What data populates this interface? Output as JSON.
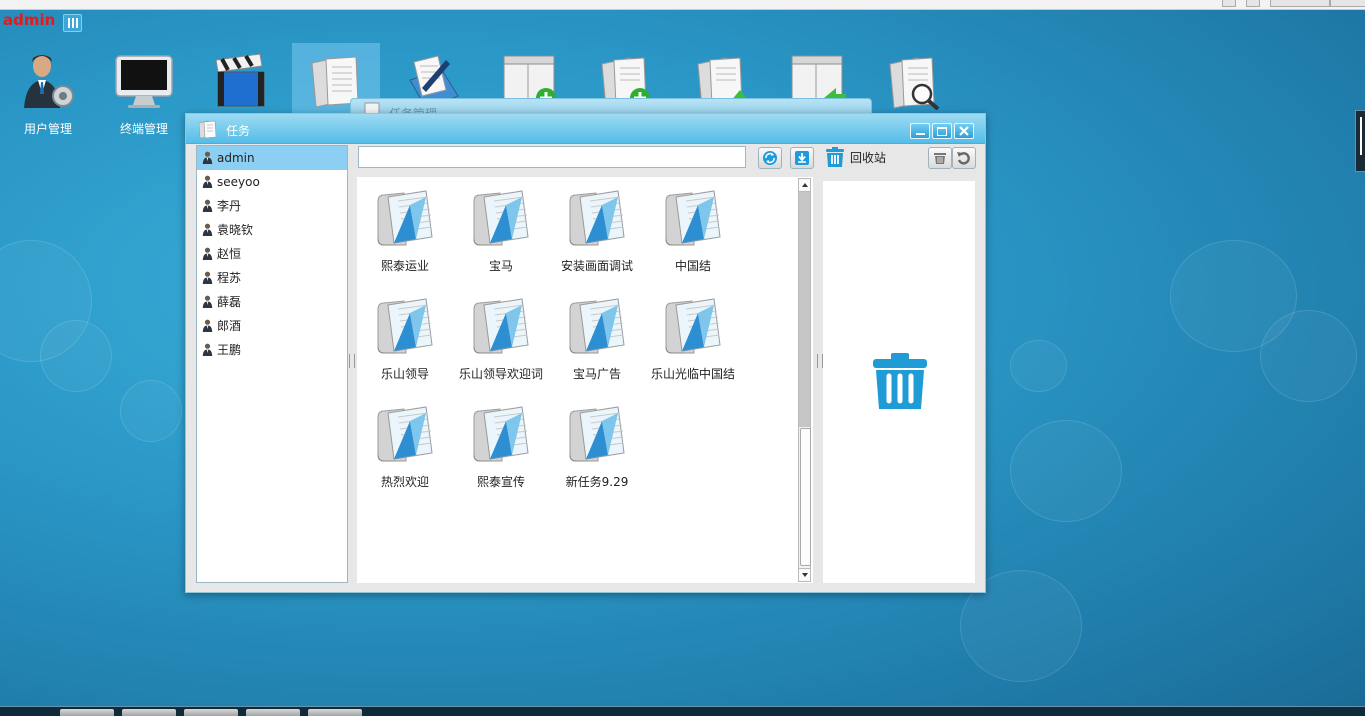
{
  "header": {
    "username": "admin"
  },
  "desktop_icons": [
    {
      "id": "user-management",
      "label": "用户管理"
    },
    {
      "id": "terminal-management",
      "label": "终端管理"
    },
    {
      "id": "media",
      "label": ""
    },
    {
      "id": "tasks",
      "label": ""
    },
    {
      "id": "edit",
      "label": ""
    },
    {
      "id": "window-add",
      "label": ""
    },
    {
      "id": "doc-add",
      "label": ""
    },
    {
      "id": "doc-up",
      "label": ""
    },
    {
      "id": "window-back",
      "label": ""
    },
    {
      "id": "doc-search",
      "label": ""
    }
  ],
  "ghost_window": {
    "title": "任务管理"
  },
  "window": {
    "title": "任务",
    "search": {
      "value": "",
      "placeholder": ""
    },
    "recycle_label": "回收站",
    "users": [
      {
        "name": "admin",
        "selected": true
      },
      {
        "name": "seeyoo",
        "selected": false
      },
      {
        "name": "李丹",
        "selected": false
      },
      {
        "name": "袁晓钦",
        "selected": false
      },
      {
        "name": "赵恒",
        "selected": false
      },
      {
        "name": "程苏",
        "selected": false
      },
      {
        "name": "薛磊",
        "selected": false
      },
      {
        "name": "郎酒",
        "selected": false
      },
      {
        "name": "王鹏",
        "selected": false
      }
    ],
    "tasks": [
      {
        "name": "熙泰运业"
      },
      {
        "name": "宝马"
      },
      {
        "name": "安装画面调试"
      },
      {
        "name": "中国结"
      },
      {
        "name": "乐山领导"
      },
      {
        "name": "乐山领导欢迎词"
      },
      {
        "name": "宝马广告"
      },
      {
        "name": "乐山光临中国结"
      },
      {
        "name": "热烈欢迎"
      },
      {
        "name": "熙泰宣传"
      },
      {
        "name": "新任务9.29"
      }
    ]
  },
  "colors": {
    "accent": "#2a9fd6",
    "title_bar": "#54bde8",
    "selected_row": "#8ccff3",
    "username_red": "#e81818",
    "bin_blue": "#1f9bd6"
  }
}
